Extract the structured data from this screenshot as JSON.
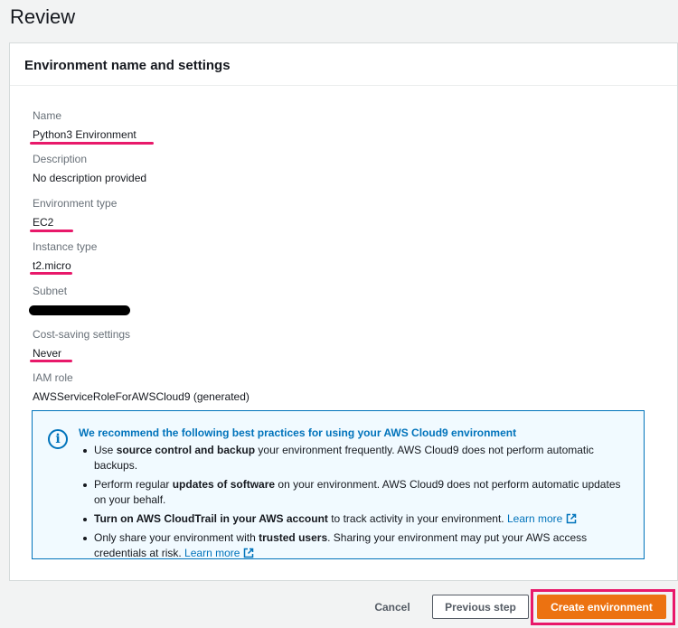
{
  "page": {
    "title": "Review"
  },
  "panel": {
    "header": "Environment name and settings",
    "fields": {
      "name": {
        "label": "Name",
        "value": "Python3 Environment"
      },
      "description": {
        "label": "Description",
        "value": "No description provided"
      },
      "env_type": {
        "label": "Environment type",
        "value": "EC2"
      },
      "instance_type": {
        "label": "Instance type",
        "value": "t2.micro"
      },
      "subnet": {
        "label": "Subnet"
      },
      "cost_saving": {
        "label": "Cost-saving settings",
        "value": "Never"
      },
      "iam_role": {
        "label": "IAM role",
        "value": "AWSServiceRoleForAWSCloud9 (generated)"
      }
    },
    "highlight_color": "#e8196a"
  },
  "info": {
    "title": "We recommend the following best practices for using your AWS Cloud9 environment",
    "items": [
      {
        "pre": "Use ",
        "bold": "source control and backup",
        "post": " your environment frequently. AWS Cloud9 does not perform automatic backups."
      },
      {
        "pre": "Perform regular ",
        "bold": "updates of software",
        "post": " on your environment. AWS Cloud9 does not perform automatic updates on your behalf."
      },
      {
        "pre": "",
        "bold": "Turn on AWS CloudTrail in your AWS account",
        "post": " to track activity in your environment. ",
        "link": "Learn more"
      },
      {
        "pre": "Only share your environment with ",
        "bold": "trusted users",
        "post": ". Sharing your environment may put your AWS access credentials at risk. ",
        "link": "Learn more"
      }
    ],
    "accent_color": "#0073bb"
  },
  "actions": {
    "cancel": "Cancel",
    "previous": "Previous step",
    "create": "Create environment",
    "create_color": "#ec7211"
  }
}
